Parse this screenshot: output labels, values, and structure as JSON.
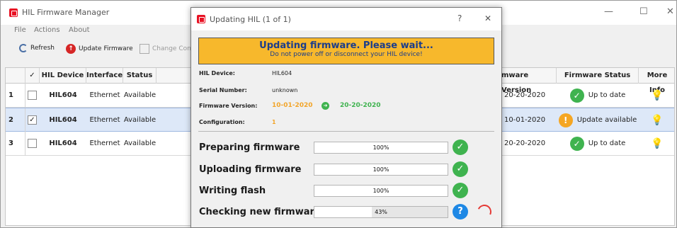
{
  "main_window": {
    "title": "HIL Firmware Manager",
    "controls": {
      "minimize": "—",
      "maximize": "☐",
      "close": "✕"
    },
    "menu": [
      "File",
      "Actions",
      "About"
    ],
    "toolbar": {
      "refresh_label": "Refresh",
      "update_label": "Update Firmware",
      "config_label": "Change Conf"
    },
    "table": {
      "headers": {
        "check": "✓",
        "device": "HIL Device",
        "interface": "Interface",
        "status": "Status",
        "fw_version": "mware Version",
        "fw_status": "Firmware Status",
        "more_info": "More Info"
      },
      "rows": [
        {
          "num": "1",
          "checked": "",
          "device": "HIL604",
          "interface": "Ethernet",
          "status": "Available",
          "fw_version": "20-20-2020",
          "fw_status": "Up to date",
          "fw_state_icon": "✓"
        },
        {
          "num": "2",
          "checked": "✓",
          "device": "HIL604",
          "interface": "Ethernet",
          "status": "Available",
          "fw_version": "10-01-2020",
          "fw_status": "Update available",
          "fw_state_icon": "!"
        },
        {
          "num": "3",
          "checked": "",
          "device": "HIL604",
          "interface": "Ethernet",
          "status": "Available",
          "fw_version": "20-20-2020",
          "fw_status": "Up to date",
          "fw_state_icon": "✓"
        }
      ],
      "info_icon": "💡"
    }
  },
  "dialog": {
    "title": "Updating HIL (1 of 1)",
    "help": "?",
    "close": "✕",
    "banner_main": "Updating firmware. Please wait...",
    "banner_sub": "Do not power off or disconnect your HIL device!",
    "device_label": "HIL Device:",
    "device_value": "HIL604",
    "serial_label": "Serial Number:",
    "serial_value": "unknown",
    "fw_label": "Firmware Version:",
    "fw_old": "10-01-2020",
    "fw_arrow": "➜",
    "fw_new": "20-20-2020",
    "config_label": "Configuration:",
    "config_value": "1",
    "steps": [
      {
        "label": "Preparing firmware",
        "percent": 100,
        "percent_text": "100%",
        "state_icon": "✓"
      },
      {
        "label": "Uploading firmware",
        "percent": 100,
        "percent_text": "100%",
        "state_icon": "✓"
      },
      {
        "label": "Writing flash",
        "percent": 100,
        "percent_text": "100%",
        "state_icon": "✓"
      },
      {
        "label": "Checking new firmware",
        "percent": 43,
        "percent_text": "43%",
        "state_icon": "?"
      }
    ]
  },
  "colors": {
    "banner": "#f7b82c",
    "ok": "#3fb34f",
    "warn": "#f5a623",
    "accent_red": "#e81123",
    "selection": "#dde8f8"
  }
}
